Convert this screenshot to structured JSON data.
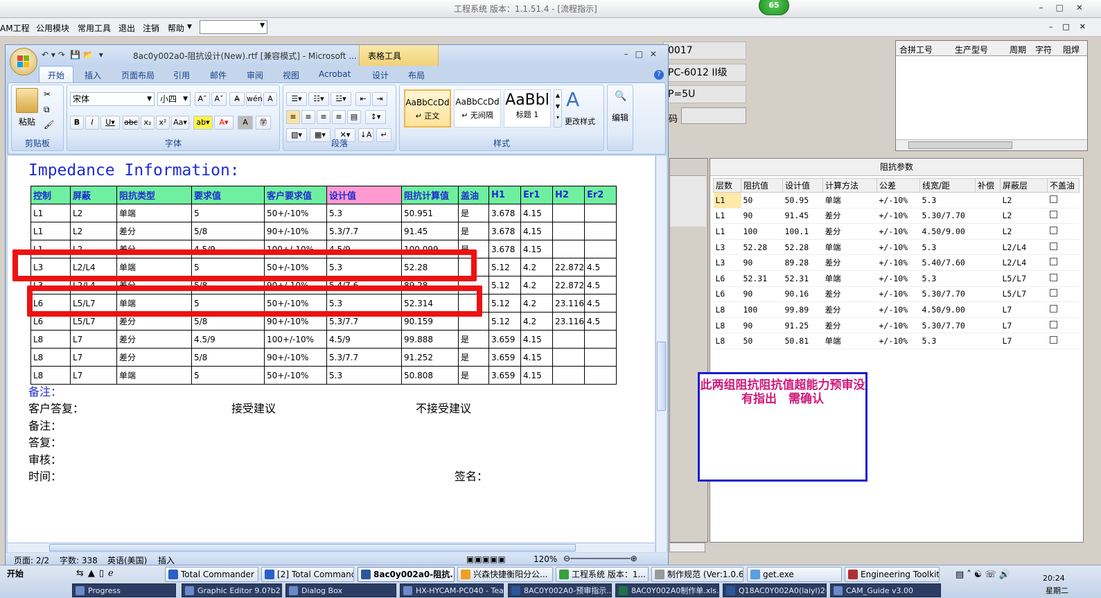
{
  "bg_app": {
    "title": "工程系统  版本：1.1.51.4 - [流程指示]",
    "badge": "65",
    "menu": [
      "AM工程",
      "公用模块",
      "常用工具",
      "退出",
      "注销",
      "帮助"
    ],
    "info_boxes": [
      "0017",
      "PC-6012 II级",
      "P=5U"
    ],
    "info_label": "码",
    "merge_label": "合拼",
    "grid_top_headers": [
      "合拼工号",
      "生产型号",
      "周期",
      "字符",
      "阻焊"
    ],
    "imp_panel_title": "阻抗参数",
    "imp_headers": [
      "层数",
      "阻抗值",
      "设计值",
      "计算方法",
      "公差",
      "线宽/距",
      "补偿",
      "屏蔽层",
      "不盖油"
    ],
    "imp_rows": [
      [
        "L1",
        "50",
        "50.95",
        "单端",
        "+/-10%",
        "5.3",
        "",
        "L2"
      ],
      [
        "L1",
        "90",
        "91.45",
        "差分",
        "+/-10%",
        "5.30/7.70",
        "",
        "L2"
      ],
      [
        "L1",
        "100",
        "100.1",
        "差分",
        "+/-10%",
        "4.50/9.00",
        "",
        "L2"
      ],
      [
        "L3",
        "52.28",
        "52.28",
        "单端",
        "+/-10%",
        "5.3",
        "",
        "L2/L4"
      ],
      [
        "L3",
        "90",
        "89.28",
        "差分",
        "+/-10%",
        "5.40/7.60",
        "",
        "L2/L4"
      ],
      [
        "L6",
        "52.31",
        "52.31",
        "单端",
        "+/-10%",
        "5.3",
        "",
        "L5/L7"
      ],
      [
        "L6",
        "90",
        "90.16",
        "差分",
        "+/-10%",
        "5.30/7.70",
        "",
        "L5/L7"
      ],
      [
        "L8",
        "100",
        "99.89",
        "差分",
        "+/-10%",
        "4.50/9.00",
        "",
        "L7"
      ],
      [
        "L8",
        "90",
        "91.25",
        "差分",
        "+/-10%",
        "5.30/7.70",
        "",
        "L7"
      ],
      [
        "L8",
        "50",
        "50.81",
        "单端",
        "+/-10%",
        "5.3",
        "",
        "L7"
      ]
    ],
    "note": "此两组阻抗阻抗值超能力预审没有指出　需确认"
  },
  "word": {
    "title": "8ac0y002a0-阻抗设计(New).rtf [兼容模式] - Microsoft ...",
    "context_tab": "表格工具",
    "tabs": [
      "开始",
      "插入",
      "页面布局",
      "引用",
      "邮件",
      "审阅",
      "视图",
      "Acrobat",
      "设计",
      "布局"
    ],
    "groups": {
      "clipboard": "剪贴板",
      "font": "字体",
      "paragraph": "段落",
      "styles": "样式",
      "editing": "编辑"
    },
    "paste_label": "粘贴",
    "font_name": "宋体",
    "font_size": "小四",
    "styles": [
      {
        "sample": "AaBbCcDd",
        "name": "↵ 正文"
      },
      {
        "sample": "AaBbCcDd",
        "name": "↵ 无间隔"
      },
      {
        "sample": "AaBbl",
        "name": "标题 1"
      }
    ],
    "change_styles": "更改样式",
    "edit_label": "编辑",
    "heading": "Impedance Information:",
    "table_headers": [
      "控制",
      "屏蔽",
      "阻抗类型",
      "要求值",
      "客户要求值",
      "设计值",
      "阻抗计算值",
      "盖油",
      "H1",
      "Er1",
      "H2",
      "Er2"
    ],
    "table_rows": [
      [
        "L1",
        "L2",
        "单端",
        "5",
        "50+/-10%",
        "5.3",
        "50.951",
        "是",
        "3.678",
        "4.15",
        "",
        ""
      ],
      [
        "L1",
        "L2",
        "差分",
        "5/8",
        "90+/-10%",
        "5.3/7.7",
        "91.45",
        "是",
        "3.678",
        "4.15",
        "",
        ""
      ],
      [
        "L1",
        "L2",
        "差分",
        "4.5/9",
        "100+/-10%",
        "4.5/9",
        "100.099",
        "是",
        "3.678",
        "4.15",
        "",
        ""
      ],
      [
        "L3",
        "L2/L4",
        "单端",
        "5",
        "50+/-10%",
        "5.3",
        "52.28",
        "",
        "5.12",
        "4.2",
        "22.872",
        "4.5"
      ],
      [
        "L3",
        "L2/L4",
        "差分",
        "5/8",
        "90+/-10%",
        "5.4/7.6",
        "89.28",
        "",
        "5.12",
        "4.2",
        "22.872",
        "4.5"
      ],
      [
        "L6",
        "L5/L7",
        "单端",
        "5",
        "50+/-10%",
        "5.3",
        "52.314",
        "",
        "5.12",
        "4.2",
        "23.116",
        "4.5"
      ],
      [
        "L6",
        "L5/L7",
        "差分",
        "5/8",
        "90+/-10%",
        "5.3/7.7",
        "90.159",
        "",
        "5.12",
        "4.2",
        "23.116",
        "4.5"
      ],
      [
        "L8",
        "L7",
        "差分",
        "4.5/9",
        "100+/-10%",
        "4.5/9",
        "99.888",
        "是",
        "3.659",
        "4.15",
        "",
        ""
      ],
      [
        "L8",
        "L7",
        "差分",
        "5/8",
        "90+/-10%",
        "5.3/7.7",
        "91.252",
        "是",
        "3.659",
        "4.15",
        "",
        ""
      ],
      [
        "L8",
        "L7",
        "单端",
        "5",
        "50+/-10%",
        "5.3",
        "50.808",
        "是",
        "3.659",
        "4.15",
        "",
        ""
      ]
    ],
    "remark1": "备注：",
    "customer_reply": "客户答复：",
    "accept": "接受建议",
    "reject": "不接受建议",
    "remark2": "备注：",
    "reply": "答复：",
    "review": "审核：",
    "time": "时间：",
    "sign": "签名：",
    "status": {
      "page": "页面: 2/2",
      "words": "字数: 338",
      "lang": "英语(美国)",
      "mode": "插入",
      "zoom": "120%"
    }
  },
  "taskbar": {
    "start": "开始",
    "row1": [
      "Total Commander 7....",
      "[2] Total Commande...",
      "8ac0y002a0-阻抗...",
      "兴森快捷衡阳分公...",
      "工程系统  版本：1...",
      "制作规范 (Ver:1.0.6)",
      "get.exe",
      "Engineering Toolkit 9..."
    ],
    "row2": [
      "Progress",
      "Graphic Editor 9.0?b2 (9...",
      "Dialog Box",
      "HX-HYCAM-PC040 - Tea...",
      "8AC0Y002A0-预审指示...",
      "8AC0Y002A0制作单.xls...",
      "Q18AC0Y002A0(laiyl)20...",
      "CAM_Guide v3.00"
    ],
    "clock": "20:24",
    "weekday": "星期二"
  }
}
